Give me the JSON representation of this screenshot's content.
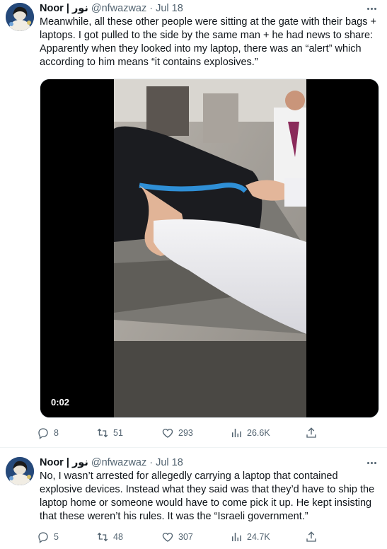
{
  "tweets": [
    {
      "name": "Noor | نور",
      "handle": "@nfwazwaz",
      "separator": "·",
      "time": "Jul 18",
      "text_lines": [
        "Meanwhile, all these other people were sitting at the gate with their bags +",
        "laptops. I got pulled to the side by the same man + he had news to share:",
        "Apparently when they looked into my laptop, there was an “alert” which",
        "according to him means “it contains explosives.”"
      ],
      "video_duration": "0:02",
      "stats": {
        "replies": "8",
        "retweets": "51",
        "likes": "293",
        "views": "26.6K"
      }
    },
    {
      "name": "Noor | نور",
      "handle": "@nfwazwaz",
      "separator": "·",
      "time": "Jul 18",
      "text_lines": [
        "No, I wasn’t arrested for allegedly carrying a laptop that contained",
        "explosive devices. Instead what they said was that they’d have to ship the",
        "laptop home or someone would have to come pick it up. He kept insisting",
        "that these weren’t his rules. It was the “Israeli government.”"
      ],
      "stats": {
        "replies": "5",
        "retweets": "48",
        "likes": "307",
        "views": "24.7K"
      }
    }
  ],
  "icons": {
    "reply": "reply-icon",
    "retweet": "retweet-icon",
    "like": "heart-icon",
    "views": "analytics-icon",
    "share": "share-icon",
    "more": "more-icon"
  },
  "colors": {
    "text": "#0f1419",
    "secondary": "#536471",
    "divider": "#eff3f4"
  }
}
